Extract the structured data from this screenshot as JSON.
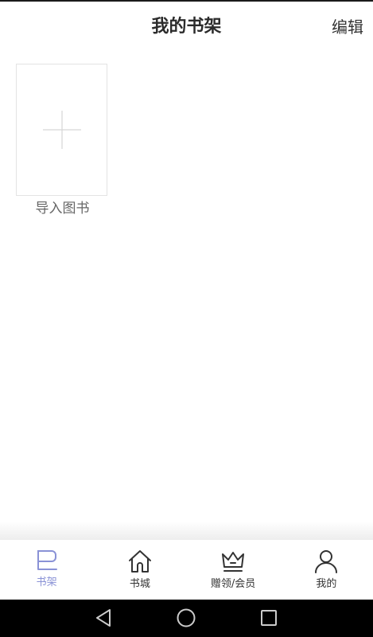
{
  "header": {
    "title": "我的书架",
    "edit_label": "编辑"
  },
  "shelf": {
    "import_label": "导入图书"
  },
  "bottom_nav": {
    "items": [
      {
        "label": "书架",
        "icon": "bookshelf-icon",
        "active": true
      },
      {
        "label": "书城",
        "icon": "home-icon",
        "active": false
      },
      {
        "label": "赠领/会员",
        "icon": "crown-icon",
        "active": false
      },
      {
        "label": "我的",
        "icon": "user-icon",
        "active": false
      }
    ]
  },
  "system_nav": {
    "icons": [
      "back-icon",
      "home-circle-icon",
      "recents-icon"
    ]
  },
  "colors": {
    "active_nav": "#8a92d6",
    "inactive_nav": "#333333",
    "title": "#2b2b2b",
    "card_border": "#e3e3e3",
    "system_bar": "#000000"
  }
}
